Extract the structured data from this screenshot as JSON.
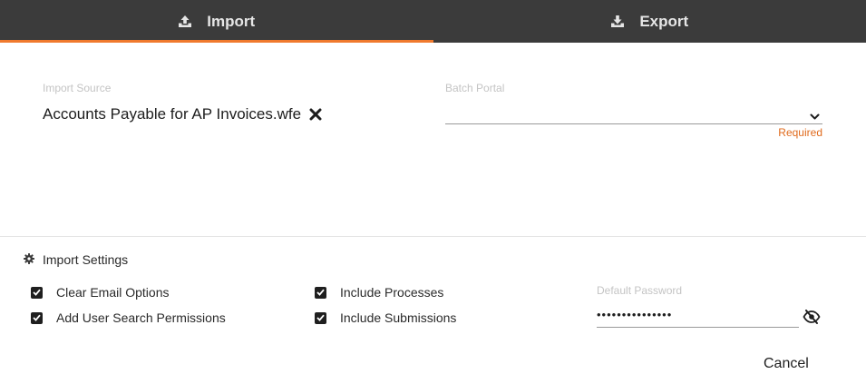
{
  "tabs": {
    "import": {
      "label": "Import",
      "icon": "upload-icon"
    },
    "export": {
      "label": "Export",
      "icon": "download-icon"
    }
  },
  "import_source": {
    "label": "Import Source",
    "value": "Accounts Payable for AP Invoices.wfe"
  },
  "batch_portal": {
    "label": "Batch Portal",
    "value": "",
    "validation": "Required"
  },
  "settings": {
    "title": "Import Settings",
    "options": [
      {
        "label": "Clear Email Options",
        "checked": true
      },
      {
        "label": "Add User Search Permissions",
        "checked": true
      },
      {
        "label": "Include Processes",
        "checked": true
      },
      {
        "label": "Include Submissions",
        "checked": true
      }
    ],
    "default_password": {
      "label": "Default Password",
      "value": "•••••••••••••••"
    }
  },
  "footer": {
    "cancel_label": "Cancel"
  },
  "colors": {
    "accent": "#f07a2e",
    "tabbar": "#3b3b3b",
    "error": "#e06a1c"
  }
}
